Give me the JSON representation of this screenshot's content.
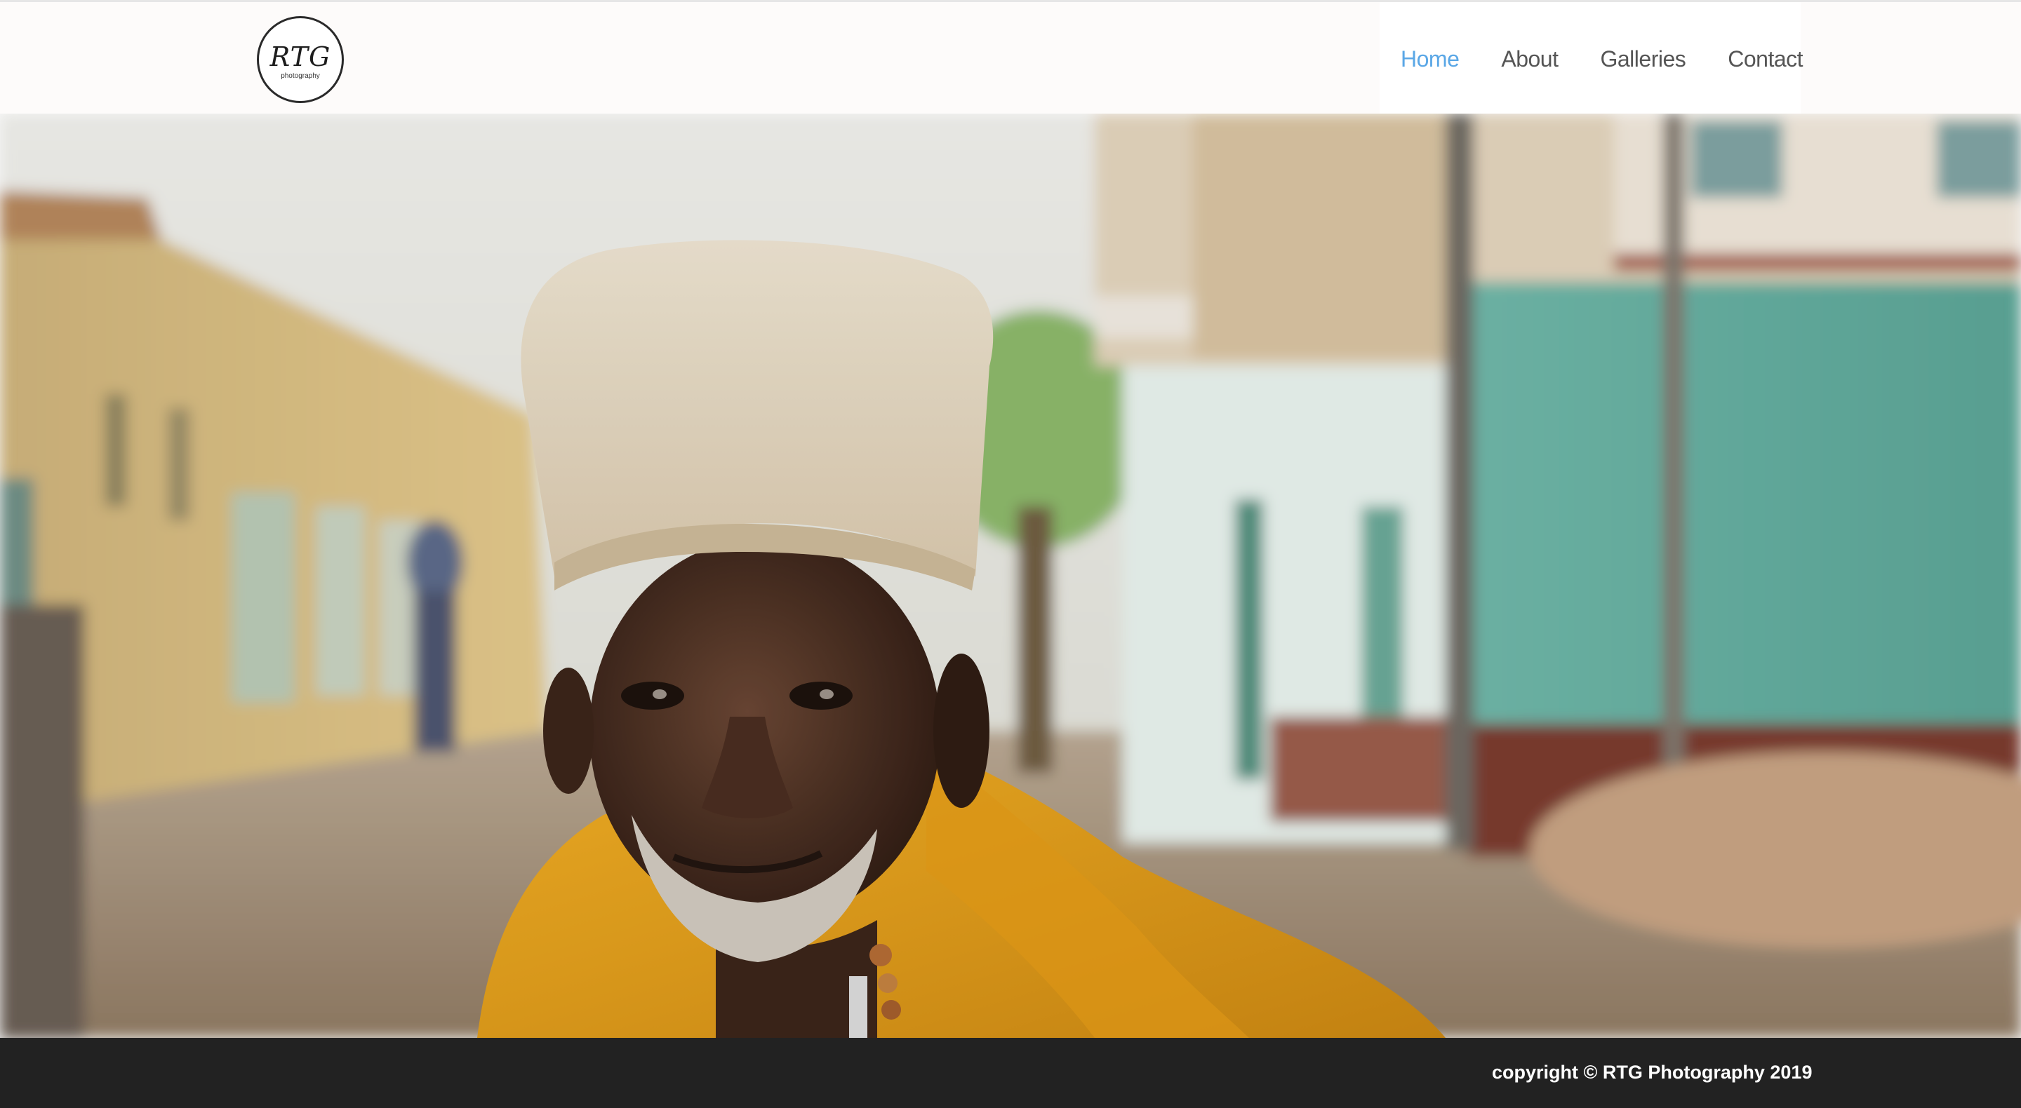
{
  "header": {
    "logo": {
      "mark": "RTG",
      "subtitle": "photography"
    },
    "nav": [
      {
        "label": "Home",
        "active": true
      },
      {
        "label": "About",
        "active": false
      },
      {
        "label": "Galleries",
        "active": false
      },
      {
        "label": "Contact",
        "active": false
      }
    ]
  },
  "hero": {
    "slides_count": 6,
    "active_slide": 6
  },
  "footer": {
    "copyright": "copyright © RTG Photography 2019"
  },
  "colors": {
    "nav_active": "#5aa7e6",
    "nav_text": "#555555",
    "footer_bg": "#222222",
    "header_bg": "#fdfbfa"
  }
}
